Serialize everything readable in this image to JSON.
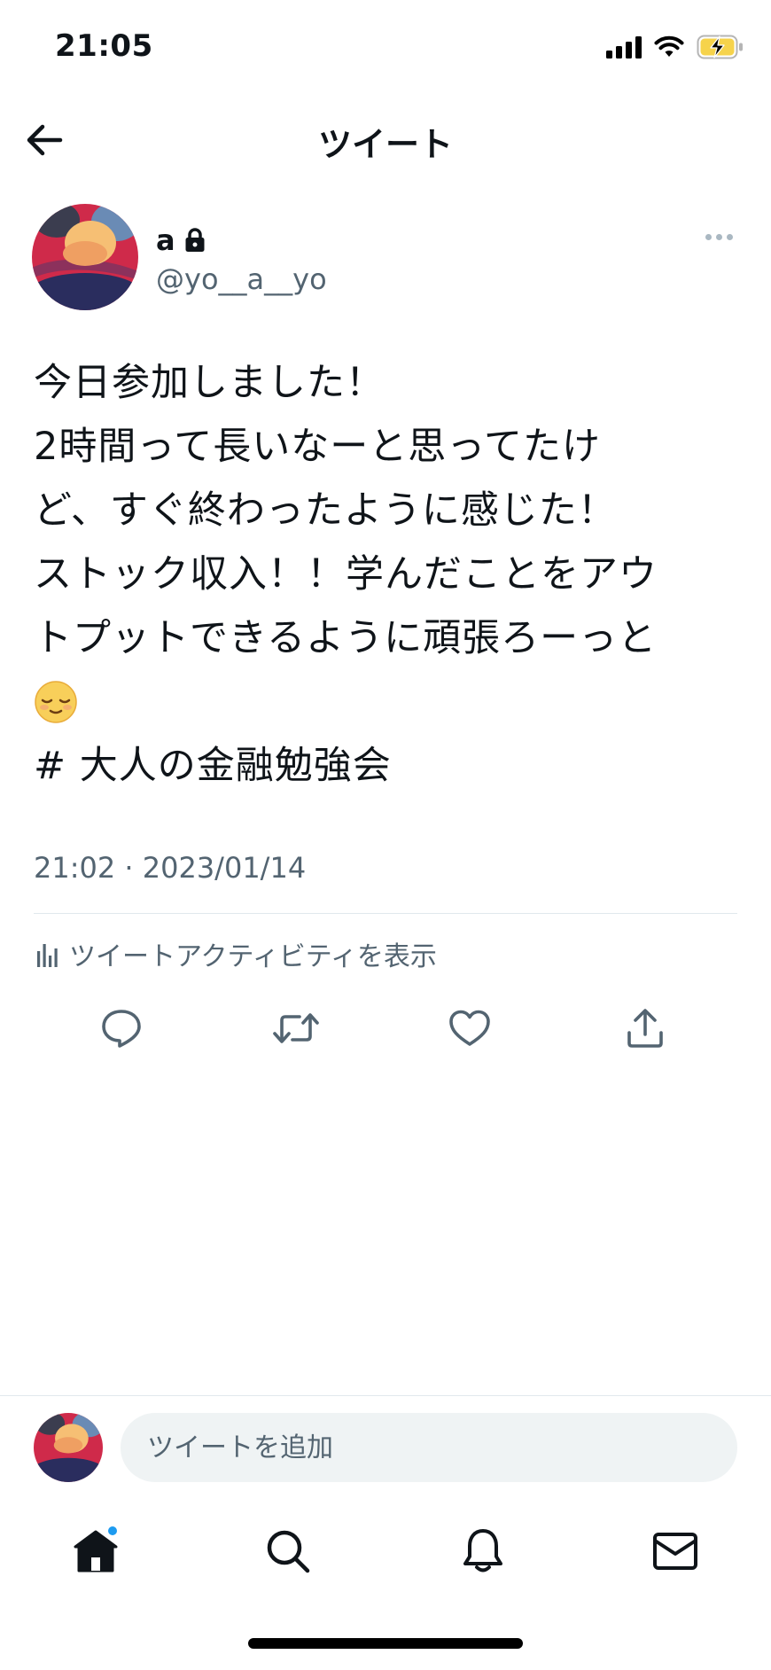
{
  "status_bar": {
    "time": "21:05",
    "icons": [
      "signal-icon",
      "wifi-icon",
      "battery-charging-icon"
    ],
    "battery_color": "#f6d34b"
  },
  "header": {
    "back_icon": "arrow-left-icon",
    "title": "ツイート"
  },
  "tweet": {
    "author": {
      "name": "a",
      "protected_icon": "lock-icon",
      "handle": "@yo__a__yo"
    },
    "more_icon": "more-icon",
    "text_lines": [
      "今日参加しました！",
      "2時間って長いなーと思ってたけ",
      "ど、すぐ終わったように感じた！",
      "ストック収入！！学んだことをアウ",
      "トプットできるように頑張ろーっと"
    ],
    "emoji": "😌",
    "hashtag": "# 大人の金融勉強会",
    "timestamp": "21:02 · 2023/01/14",
    "activity_icon": "bar-chart-icon",
    "activity_label": "ツイートアクティビティを表示",
    "actions": [
      "reply-icon",
      "retweet-icon",
      "like-icon",
      "share-icon"
    ]
  },
  "composer": {
    "placeholder": "ツイートを追加"
  },
  "tab_bar": {
    "items": [
      "home-icon",
      "search-icon",
      "notifications-icon",
      "messages-icon"
    ],
    "accent": "#1d9bf0"
  }
}
